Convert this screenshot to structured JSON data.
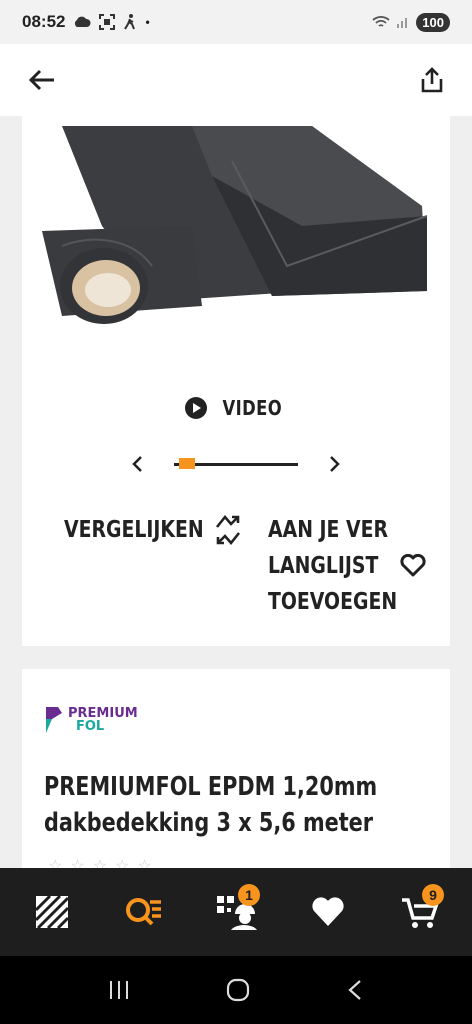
{
  "status_bar": {
    "time": "08:52",
    "battery": "100"
  },
  "product": {
    "video_label": "VIDEO",
    "compare_label": "VERGELIJKEN",
    "wishlist_lines": [
      "AAN JE VER",
      "LANGLIJST",
      "TOEVOEGEN"
    ],
    "gallery_position": 0.05,
    "brand_line1": "PREMIUM",
    "brand_line2": "FOL",
    "title_line1": "PREMIUMFOL EPDM 1,20mm",
    "title_line2": "dakbedekking 3 x 5,6 meter"
  },
  "bottom_nav": {
    "items": [
      {
        "icon": "categories-icon"
      },
      {
        "icon": "search-icon"
      },
      {
        "icon": "scan-worker-icon",
        "badge": "1"
      },
      {
        "icon": "heart-icon"
      },
      {
        "icon": "cart-icon",
        "badge": "9"
      }
    ]
  },
  "colors": {
    "accent": "#f7941d",
    "nav_bg": "#1e1e1e",
    "brand_purple": "#6a2c91",
    "brand_teal": "#1aa9a0"
  }
}
